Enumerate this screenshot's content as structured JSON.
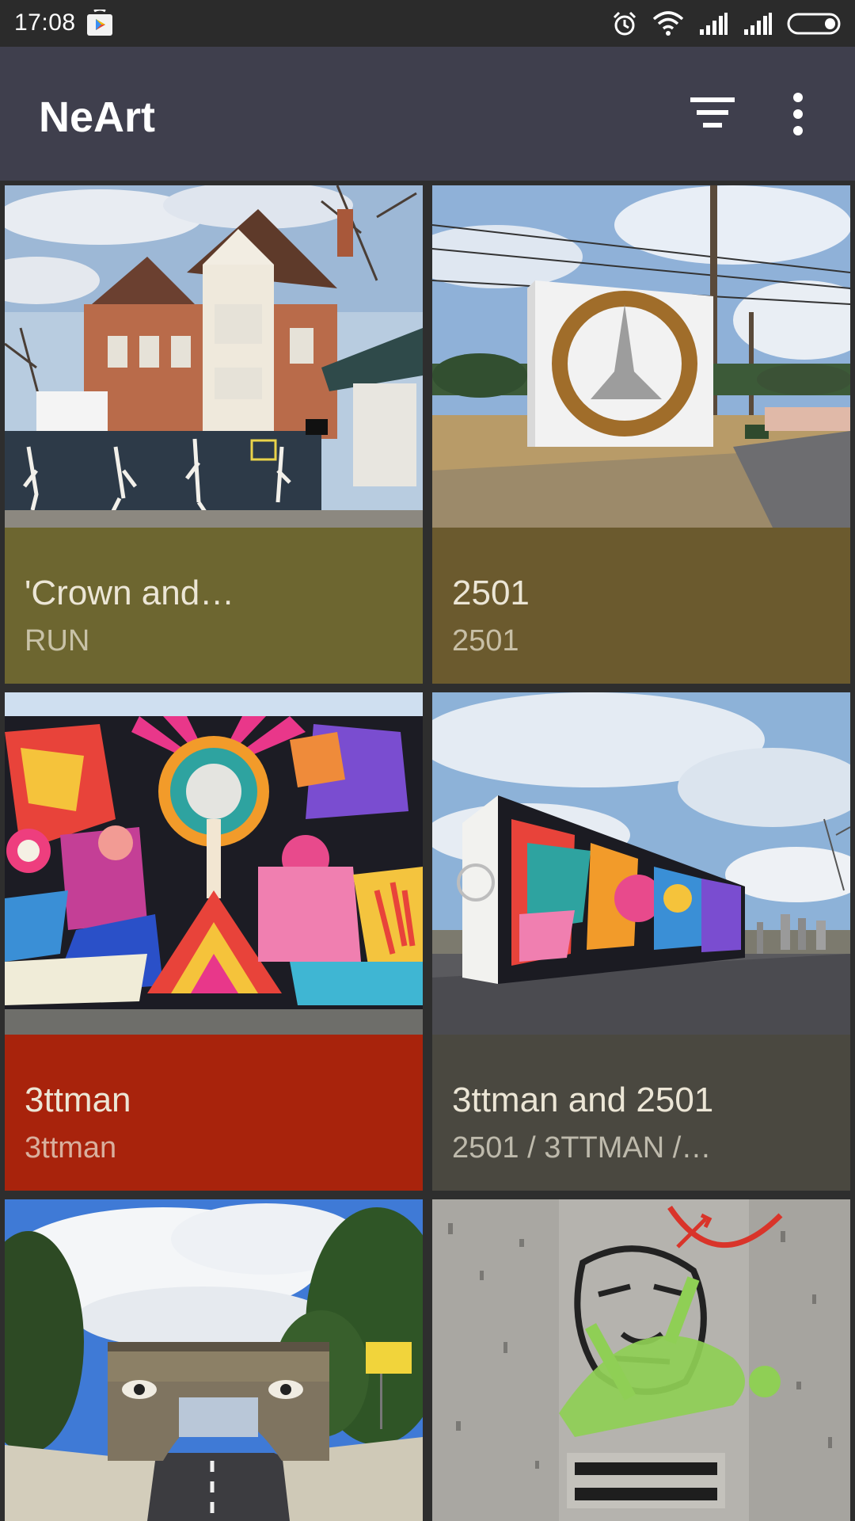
{
  "status_bar": {
    "time": "17:08",
    "icons": [
      "play-store-icon",
      "alarm-icon",
      "wifi-icon",
      "signal-icon",
      "signal-icon",
      "battery-icon"
    ]
  },
  "app_bar": {
    "title": "NeArt",
    "actions": [
      "filter-icon",
      "more-vert-icon"
    ]
  },
  "cards": [
    {
      "title": "'Crown and…",
      "subtitle": "RUN",
      "caption_color": "#6d6630"
    },
    {
      "title": "2501",
      "subtitle": "2501",
      "caption_color": "#6b5a2e"
    },
    {
      "title": "3ttman",
      "subtitle": "3ttman",
      "caption_color": "#a8230c"
    },
    {
      "title": "3ttman and 2501",
      "subtitle": "2501 / 3TTMAN /…",
      "caption_color": "#4a4840"
    },
    {
      "title": "",
      "subtitle": ""
    },
    {
      "title": "",
      "subtitle": ""
    }
  ],
  "colors": {
    "status_bar": "#2b2b2b",
    "app_bar": "#3f3f4d",
    "background": "#2e2e2e"
  }
}
